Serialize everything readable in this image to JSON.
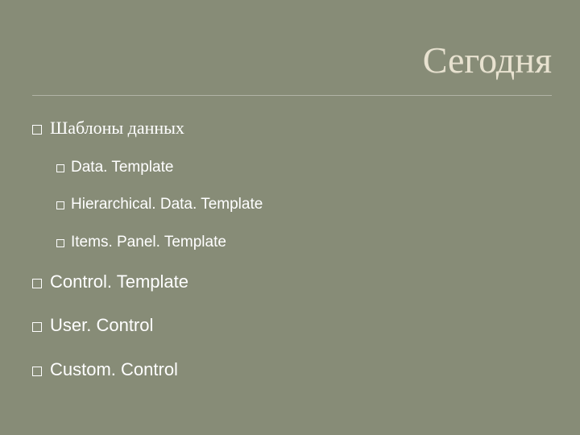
{
  "title": "Сегодня",
  "items": {
    "0": {
      "label": "Шаблоны данных"
    },
    "1": {
      "label": "Data. Template"
    },
    "2": {
      "label": "Hierarchical. Data. Template"
    },
    "3": {
      "label": "Items. Panel. Template"
    },
    "4": {
      "label": "Control. Template"
    },
    "5": {
      "label": "User. Control"
    },
    "6": {
      "label": "Custom. Control"
    }
  }
}
